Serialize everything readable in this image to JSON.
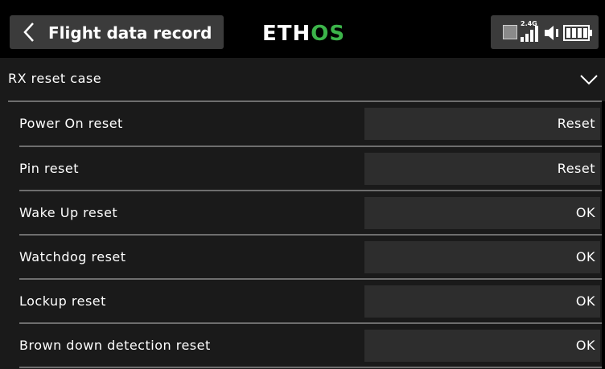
{
  "header": {
    "title": "Flight data record",
    "logo_white": "ETH",
    "logo_green": "OS",
    "rf_band": "2.4G",
    "back_icon": "chevron-left-icon",
    "colors": {
      "accent": "#3cb44a",
      "pill": "#3b3b3b"
    }
  },
  "section": {
    "label": "RX reset case",
    "expand_icon": "chevron-down-icon"
  },
  "rows": [
    {
      "label": "Power On reset",
      "value": "Reset"
    },
    {
      "label": "Pin reset",
      "value": "Reset"
    },
    {
      "label": "Wake Up reset",
      "value": "OK"
    },
    {
      "label": "Watchdog reset",
      "value": "OK"
    },
    {
      "label": "Lockup reset",
      "value": "OK"
    },
    {
      "label": "Brown down detection reset",
      "value": "OK"
    }
  ]
}
